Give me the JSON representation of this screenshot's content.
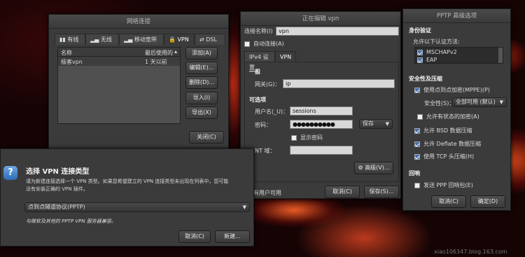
{
  "net_window": {
    "title": "网络连接",
    "tabs": [
      "有线",
      "无线",
      "移动宽带",
      "VPN",
      "DSL"
    ],
    "columns": [
      "名称",
      "最后使用的"
    ],
    "row": {
      "name": "极客vpn",
      "last_used": "1 天以前"
    },
    "buttons": [
      "添加(A)",
      "编辑(E)...",
      "删除(D)...",
      "导入(I)",
      "导出(X)"
    ],
    "close": "关闭(C)"
  },
  "edit_window": {
    "title": "正在编辑 vpn",
    "conn_name_label": "连接名称(I)",
    "conn_name_value": "vpn",
    "auto_connect": "自动连接(A)",
    "tabs": [
      "IPv4 设置",
      "VPN"
    ],
    "general_heading": "一般",
    "gateway_label": "网关(G)：",
    "gateway_value": "ip",
    "optional_heading": "可选项",
    "user_label": "用户名(_U)：",
    "user_value": "sessions",
    "password_label": "密码：",
    "password_value": "●●●●●●●●●●",
    "password_mode": "保存",
    "show_password": "显示密码",
    "nt_domain_label": "NT 域：",
    "advanced": "高级(V)...",
    "all_users": "对所有用户可用",
    "cancel": "取消(C)",
    "save": "保存(S)..."
  },
  "pptp_window": {
    "title": "PPTP 高级选项",
    "auth_heading": "身份验证",
    "allow_methods": "允许以下认证方法:",
    "methods": [
      "MSCHAPv2",
      "EAP"
    ],
    "security_heading": "安全性及压缩",
    "use_mppe": "使用点到点加密(MPPE)(P)",
    "security_label": "安全性(S)：",
    "security_value": "全部可用 (默认)",
    "stateful": "允许有状态的加密(A)",
    "bsd": "允许 BSD 数据压缩",
    "deflate": "允许 Deflate 数据压缩",
    "tcp": "使用 TCP 头压缩(H)",
    "echo_heading": "回响",
    "send_ppp": "发送 PPP 回响包(E)",
    "cancel": "取消(C)",
    "ok": "确定(D)"
  },
  "vpn_type_window": {
    "title": "选择 VPN 连接类型",
    "desc": "请为新建连接选择一个 VPN 类型。如果您希望建立的 VPN 连接类型未出现在列表中，您可能没有安装正确的 VPN 插件。",
    "selected_type": "点到点隧道协议(PPTP)",
    "compat": "与微软及其他的 PPTP VPN 服务器兼容。",
    "cancel": "取消(C)",
    "create": "新建..."
  },
  "watermark": "xiao106347.blog.163.com"
}
